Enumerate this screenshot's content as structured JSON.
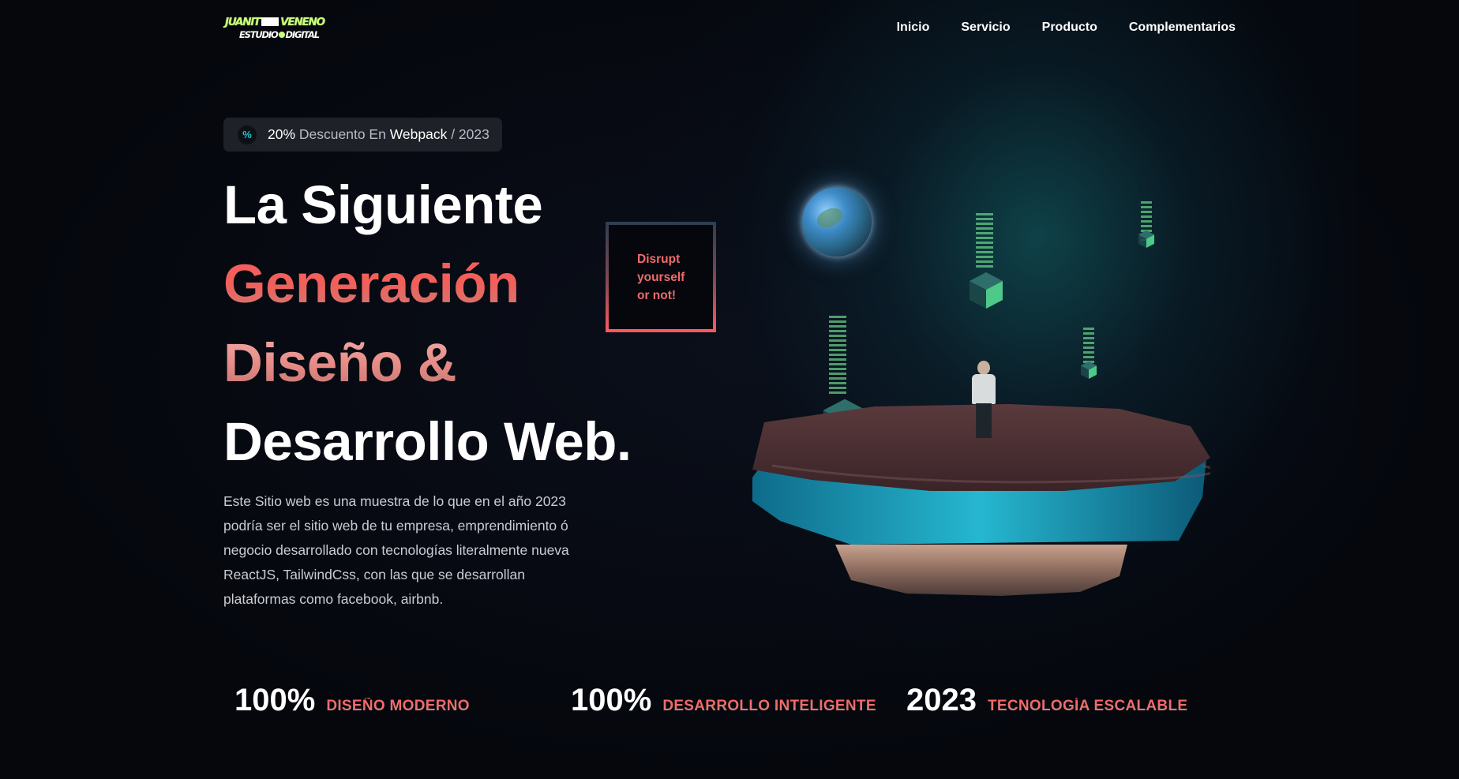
{
  "brand": {
    "logo_top": "JUANIT VENENO",
    "logo_bottom": "ESTUDIO DIGITAL"
  },
  "nav": {
    "items": [
      {
        "label": "Inicio"
      },
      {
        "label": "Servicio"
      },
      {
        "label": "Producto"
      },
      {
        "label": "Complementarios"
      }
    ]
  },
  "promo": {
    "icon": "percent-icon",
    "percent": "20%",
    "text1": " Descuento En ",
    "product": "Webpack",
    "text2": " / 2023"
  },
  "hero": {
    "line1": "La Siguiente",
    "line2": "Generación",
    "line3": "Diseño &",
    "line4": "Desarrollo Web.",
    "description": "Este Sitio web es una muestra de lo que en el año 2023 podría ser el sitio web de tu empresa, emprendimiento ó negocio desarrollado con tecnologías literalmente nueva ReactJS, TailwindCss, con las que se desarrollan plataformas como facebook, airbnb."
  },
  "disrupt": {
    "line1": "Disrupt",
    "line2": "yourself",
    "line3": "or not!"
  },
  "stats": [
    {
      "value": "100%",
      "label": "DISEÑO MODERNO"
    },
    {
      "value": "100%",
      "label": "DESARROLLO INTELIGENTE"
    },
    {
      "value": "2023",
      "label": "TECNOLOGÍA ESCALABLE"
    }
  ],
  "colors": {
    "background": "#05070d",
    "accent_red": "#ff5c5c",
    "accent_pink": "#e48984",
    "brand_green": "#c9ff7a",
    "glow_teal": "#146e73"
  }
}
